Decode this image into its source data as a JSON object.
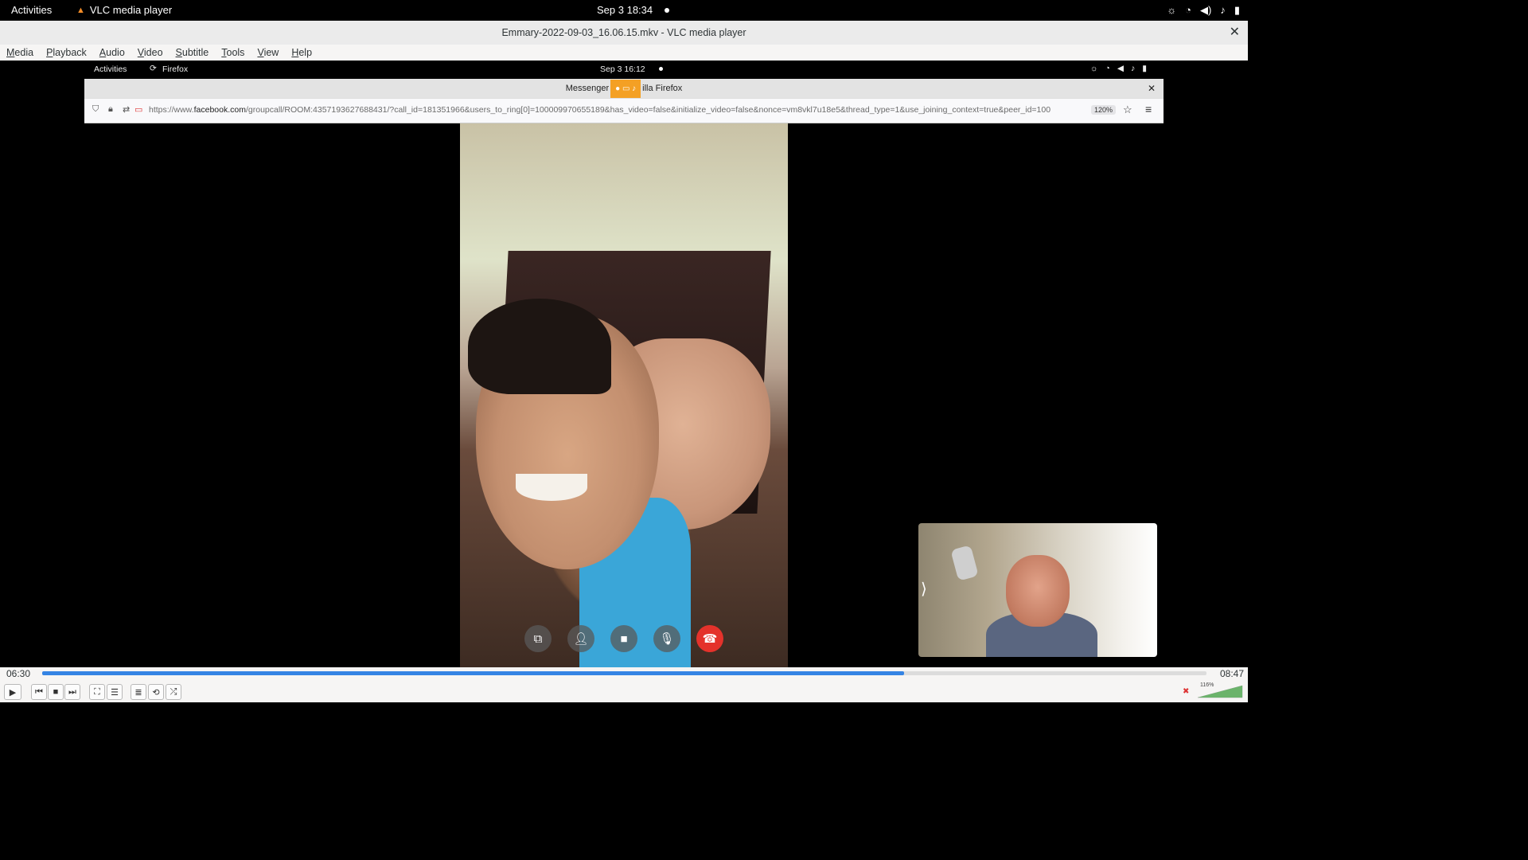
{
  "desktop_bar": {
    "activities": "Activities",
    "app_name": "VLC media player",
    "clock": "Sep 3  18:34"
  },
  "vlc": {
    "window_title": "Emmary-2022-09-03_16.06.15.mkv - VLC media player",
    "menu": [
      "Media",
      "Playback",
      "Audio",
      "Video",
      "Subtitle",
      "Tools",
      "View",
      "Help"
    ],
    "elapsed": "06:30",
    "total": "08:47",
    "progress_fraction": 0.74,
    "volume_label": "116%"
  },
  "recorded_desktop": {
    "activities": "Activities",
    "app_name": "Firefox",
    "clock": "Sep 3  16:12",
    "firefox": {
      "title_left": "Messenger",
      "title_right": "illa Firefox",
      "url_prefix": "https://www.",
      "url_domain": "facebook.com",
      "url_rest": "/groupcall/ROOM:4357193627688431/?call_id=181351966&users_to_ring[0]=100009970655189&has_video=false&initialize_video=false&nonce=vm8vkl7u18e5&thread_type=1&use_joining_context=true&peer_id=100",
      "zoom": "120%"
    }
  },
  "call_controls": [
    {
      "name": "screen-share-icon"
    },
    {
      "name": "add-person-icon"
    },
    {
      "name": "video-camera-icon"
    },
    {
      "name": "microphone-icon"
    },
    {
      "name": "end-call-icon"
    }
  ]
}
